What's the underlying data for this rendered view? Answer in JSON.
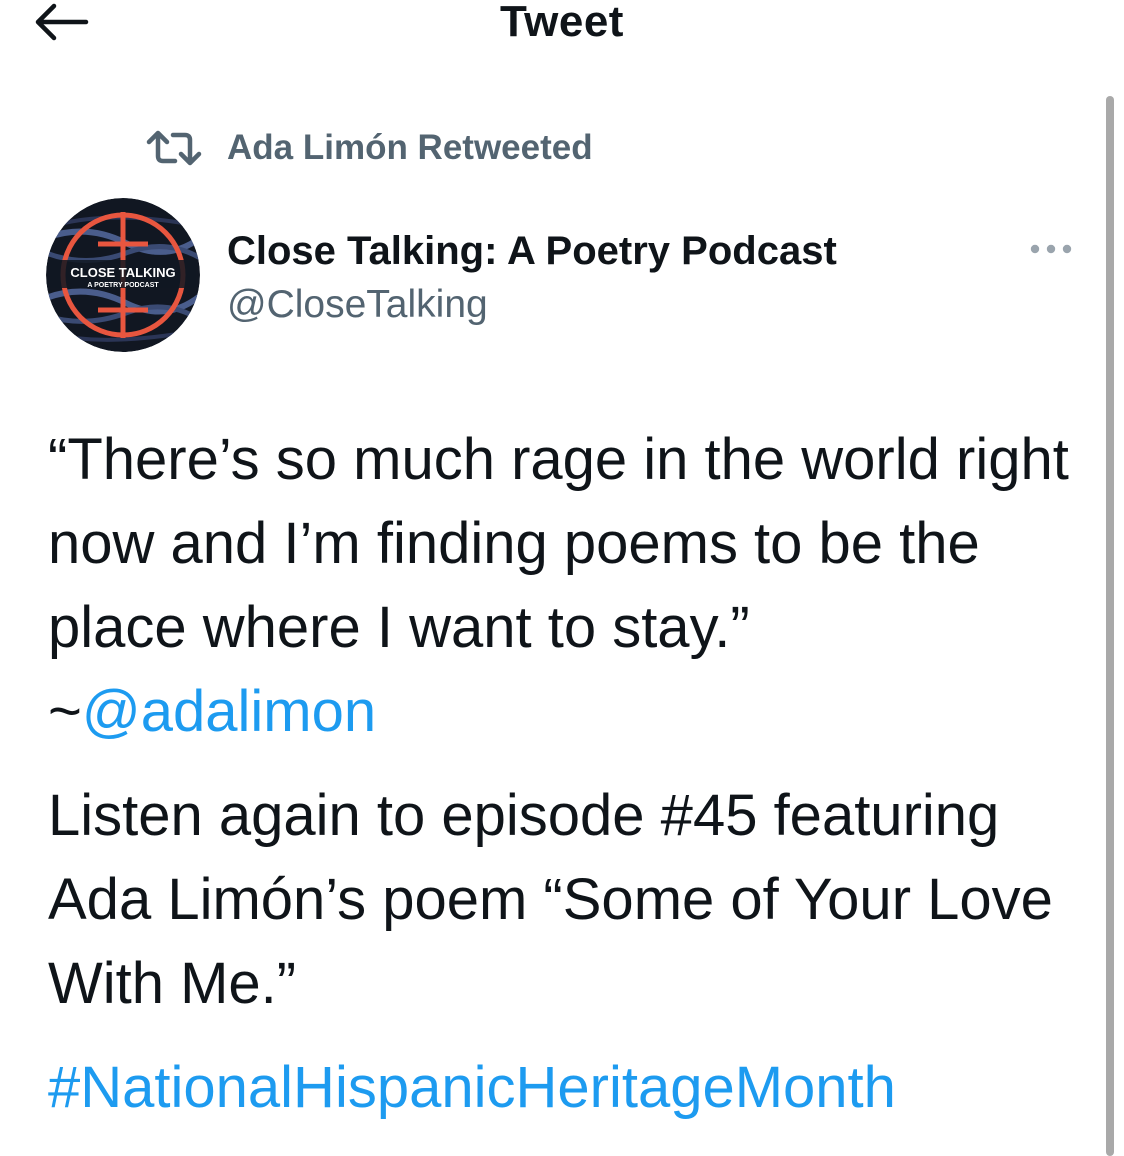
{
  "header": {
    "title": "Tweet",
    "back_icon": "arrow-left-icon"
  },
  "retweet": {
    "icon": "retweet-icon",
    "label": "Ada Limón Retweeted",
    "color": "#536471"
  },
  "author": {
    "name": "Close Talking: A Poetry Podcast",
    "handle": "@CloseTalking",
    "avatar_title": "CLOSE TALKING",
    "avatar_subtitle": "A POETRY PODCAST"
  },
  "tweet": {
    "quote": "“There’s so much rage in the world right now and I’m finding poems to be the place where I want to stay.”",
    "mention_prefix": "~",
    "mention": "@adalimon",
    "body": "Listen again to episode #45 featuring Ada Limón’s poem “Some of Your Love With Me.”",
    "hashtag": "#NationalHispanicHeritageMonth"
  },
  "colors": {
    "link": "#1d9bf0",
    "text": "#0f1419",
    "secondary": "#536471"
  }
}
